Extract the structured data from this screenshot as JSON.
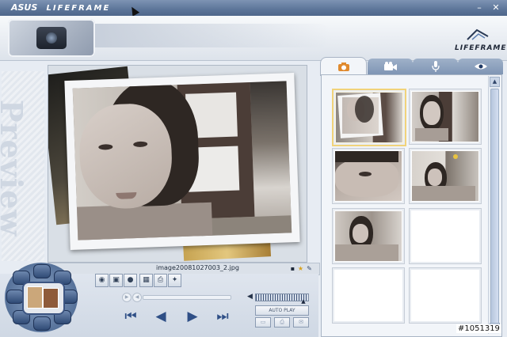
{
  "window": {
    "brand_asus": "ASUS",
    "brand_app": "LIFEFRAME",
    "controls": {
      "minimize": "–",
      "close": "✕"
    }
  },
  "header": {
    "logo_text": "LIFEFRAME"
  },
  "preview": {
    "side_label": "Preview",
    "filename": "image20081027003_2.jpg"
  },
  "tabs": [
    {
      "name": "photo",
      "icon": "camera-icon",
      "active": true
    },
    {
      "name": "video",
      "icon": "video-camera-icon",
      "active": false
    },
    {
      "name": "audio",
      "icon": "microphone-icon",
      "active": false
    },
    {
      "name": "monitor",
      "icon": "eye-icon",
      "active": false
    }
  ],
  "thumbnails": [
    {
      "state": "photo",
      "selected": true
    },
    {
      "state": "photo",
      "selected": false
    },
    {
      "state": "photo",
      "selected": false
    },
    {
      "state": "photo",
      "selected": false
    },
    {
      "state": "photo",
      "selected": false
    },
    {
      "state": "empty",
      "selected": false
    },
    {
      "state": "empty",
      "selected": false
    },
    {
      "state": "empty",
      "selected": false
    }
  ],
  "toolbar": {
    "tools": [
      "effects-icon",
      "frame-icon",
      "record-dot-icon",
      "grid-icon",
      "print-icon",
      "settings-wrench-icon"
    ]
  },
  "playback": {
    "autoplay_label": "AUTO PLAY",
    "volume_level": 0.9,
    "transport": [
      "first-icon",
      "previous-icon",
      "play-icon",
      "last-icon"
    ]
  },
  "watermark": "#1051319",
  "colors": {
    "accent": "#2f4f86",
    "selection": "#f1d37a",
    "titlebar": "#5c7599"
  }
}
